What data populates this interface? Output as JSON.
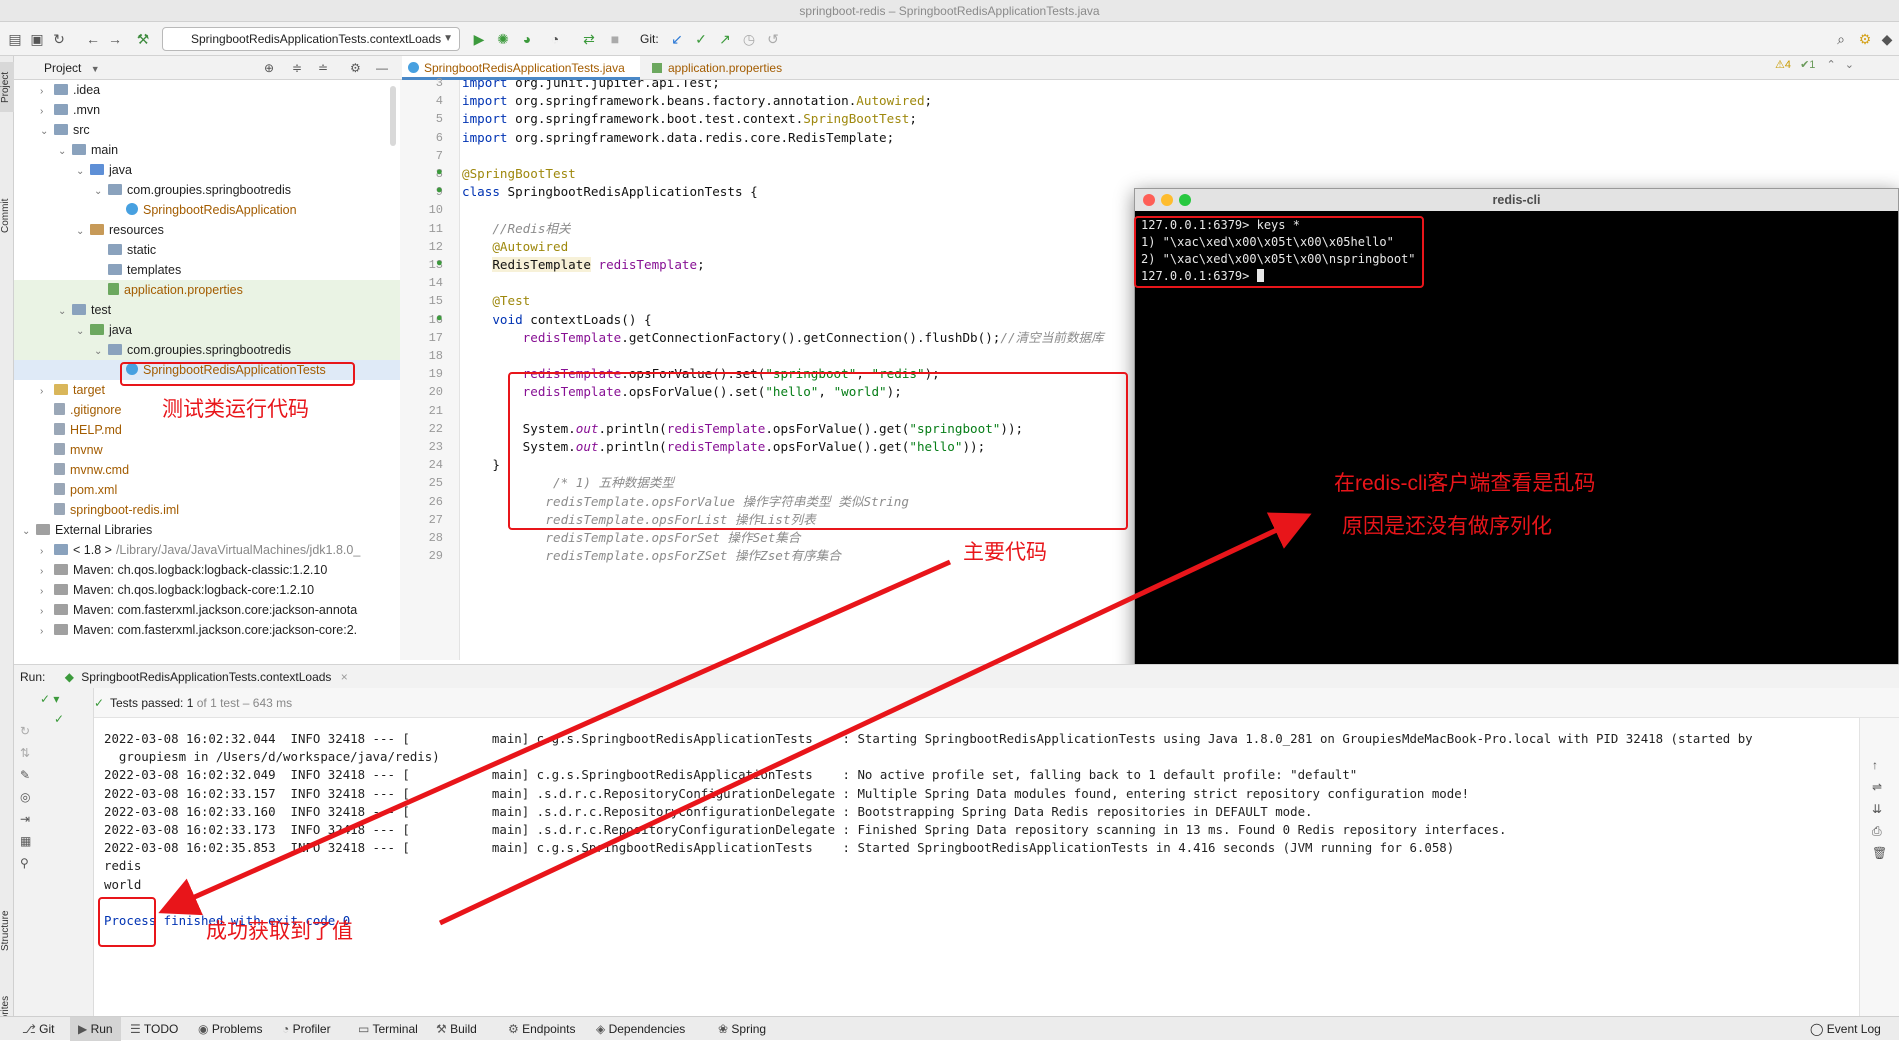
{
  "window_title": "springboot-redis – SpringbootRedisApplicationTests.java",
  "toolbar": {
    "run_config": "SpringbootRedisApplicationTests.contextLoads",
    "git_label": "Git:"
  },
  "sidebar_labels": {
    "project": "Project",
    "commit": "Commit",
    "structure": "Structure",
    "favorites": "Favorites"
  },
  "project_panel": {
    "title": "Project"
  },
  "tree": [
    {
      "label": ".idea",
      "indent": 1,
      "arrow": "›",
      "icon": "folder"
    },
    {
      "label": ".mvn",
      "indent": 1,
      "arrow": "›",
      "icon": "folder"
    },
    {
      "label": "src",
      "indent": 1,
      "arrow": "⌄",
      "icon": "folder"
    },
    {
      "label": "main",
      "indent": 2,
      "arrow": "⌄",
      "icon": "folder"
    },
    {
      "label": "java",
      "indent": 3,
      "arrow": "⌄",
      "icon": "folder-b"
    },
    {
      "label": "com.groupies.springbootredis",
      "indent": 4,
      "arrow": "⌄",
      "icon": "package"
    },
    {
      "label": "SpringbootRedisApplication",
      "indent": 5,
      "arrow": "",
      "icon": "class",
      "color": "#a35c00"
    },
    {
      "label": "resources",
      "indent": 3,
      "arrow": "⌄",
      "icon": "folder-o"
    },
    {
      "label": "static",
      "indent": 4,
      "arrow": "",
      "icon": "folder"
    },
    {
      "label": "templates",
      "indent": 4,
      "arrow": "",
      "icon": "folder"
    },
    {
      "label": "application.properties",
      "indent": 4,
      "arrow": "",
      "icon": "props",
      "color": "#a35c00"
    },
    {
      "label": "test",
      "indent": 2,
      "arrow": "⌄",
      "icon": "folder"
    },
    {
      "label": "java",
      "indent": 3,
      "arrow": "⌄",
      "icon": "folder-g"
    },
    {
      "label": "com.groupies.springbootredis",
      "indent": 4,
      "arrow": "⌄",
      "icon": "package"
    },
    {
      "label": "SpringbootRedisApplicationTests",
      "indent": 5,
      "arrow": "",
      "icon": "class",
      "color": "#a35c00"
    },
    {
      "label": "target",
      "indent": 1,
      "arrow": "›",
      "icon": "folder-y",
      "color": "#a35c00"
    },
    {
      "label": ".gitignore",
      "indent": 1,
      "arrow": "",
      "icon": "file",
      "color": "#a35c00"
    },
    {
      "label": "HELP.md",
      "indent": 1,
      "arrow": "",
      "icon": "file",
      "color": "#a35c00"
    },
    {
      "label": "mvnw",
      "indent": 1,
      "arrow": "",
      "icon": "file",
      "color": "#a35c00"
    },
    {
      "label": "mvnw.cmd",
      "indent": 1,
      "arrow": "",
      "icon": "file",
      "color": "#a35c00"
    },
    {
      "label": "pom.xml",
      "indent": 1,
      "arrow": "",
      "icon": "file",
      "color": "#a35c00"
    },
    {
      "label": "springboot-redis.iml",
      "indent": 1,
      "arrow": "",
      "icon": "file",
      "color": "#a35c00"
    },
    {
      "label": "External Libraries",
      "indent": 0,
      "arrow": "⌄",
      "icon": "lib"
    },
    {
      "label": "< 1.8 >",
      "suffix": "/Library/Java/JavaVirtualMachines/jdk1.8.0_",
      "indent": 1,
      "arrow": "›",
      "icon": "folder"
    },
    {
      "label": "Maven: ch.qos.logback:logback-classic:1.2.10",
      "indent": 1,
      "arrow": "›",
      "icon": "lib"
    },
    {
      "label": "Maven: ch.qos.logback:logback-core:1.2.10",
      "indent": 1,
      "arrow": "›",
      "icon": "lib"
    },
    {
      "label": "Maven: com.fasterxml.jackson.core:jackson-annota",
      "indent": 1,
      "arrow": "›",
      "icon": "lib"
    },
    {
      "label": "Maven: com.fasterxml.jackson.core:jackson-core:2.",
      "indent": 1,
      "arrow": "›",
      "icon": "lib"
    }
  ],
  "editor_tabs": [
    "SpringbootRedisApplicationTests.java",
    "application.properties"
  ],
  "inspections": {
    "warnings": "4",
    "weak": "1"
  },
  "code": [
    {
      "n": "3",
      "html": "<span class='kw'>import</span> org.junit.jupiter.api.Test;"
    },
    {
      "n": "4",
      "html": "<span class='kw'>import</span> org.springframework.beans.factory.annotation.<span class='ann'>Autowired</span>;"
    },
    {
      "n": "5",
      "html": "<span class='kw'>import</span> org.springframework.boot.test.context.<span class='ann'>SpringBootTest</span>;"
    },
    {
      "n": "6",
      "html": "<span class='kw'>import</span> org.springframework.data.redis.core.RedisTemplate;"
    },
    {
      "n": "7",
      "html": ""
    },
    {
      "n": "8",
      "html": "<span class='ann'>@SpringBootTest</span>"
    },
    {
      "n": "9",
      "html": "<span class='kw'>class</span> SpringbootRedisApplicationTests {"
    },
    {
      "n": "10",
      "html": ""
    },
    {
      "n": "11",
      "html": "    <span class='cmt'>//Redis相关</span>"
    },
    {
      "n": "12",
      "html": "    <span class='ann'>@Autowired</span>"
    },
    {
      "n": "13",
      "html": "    <span style='background:#f7f1d8'>RedisTemplate</span> <span class='fld'>redisTemplate</span>;"
    },
    {
      "n": "14",
      "html": ""
    },
    {
      "n": "15",
      "html": "    <span class='ann'>@Test</span>"
    },
    {
      "n": "16",
      "html": "    <span class='kw'>void</span> contextLoads() {"
    },
    {
      "n": "17",
      "html": "        <span class='fld'>redisTemplate</span>.getConnectionFactory().getConnection().flushDb();<span class='cmt'>//清空当前数据库</span>"
    },
    {
      "n": "18",
      "html": ""
    },
    {
      "n": "19",
      "html": "        <span class='fld'>redisTemplate</span>.opsForValue().set(<span class='str'>\"springboot\"</span>, <span class='str'>\"redis\"</span>);"
    },
    {
      "n": "20",
      "html": "        <span class='fld'>redisTemplate</span>.opsForValue().set(<span class='str'>\"hello\"</span>, <span class='str'>\"world\"</span>);"
    },
    {
      "n": "21",
      "html": ""
    },
    {
      "n": "22",
      "html": "        System.<span class='fld' style='font-style:italic'>out</span>.println(<span class='fld'>redisTemplate</span>.opsForValue().get(<span class='str'>\"springboot\"</span>));"
    },
    {
      "n": "23",
      "html": "        System.<span class='fld' style='font-style:italic'>out</span>.println(<span class='fld'>redisTemplate</span>.opsForValue().get(<span class='str'>\"hello\"</span>));"
    },
    {
      "n": "24",
      "html": "    }"
    },
    {
      "n": "25",
      "html": "            <span class='cmt'>/* 1) 五种数据类型</span>"
    },
    {
      "n": "26",
      "html": "           <span class='cmt'>redisTemplate.opsForValue 操作字符串类型 类似String</span>"
    },
    {
      "n": "27",
      "html": "           <span class='cmt'>redisTemplate.opsForList 操作List列表</span>"
    },
    {
      "n": "28",
      "html": "           <span class='cmt'>redisTemplate.opsForSet 操作Set集合</span>"
    },
    {
      "n": "29",
      "html": "           <span class='cmt'>redisTemplate.opsForZSet 操作Zset有序集合</span>"
    }
  ],
  "terminal": {
    "title": "redis-cli",
    "lines": [
      "127.0.0.1:6379> keys *",
      "1) \"\\xac\\xed\\x00\\x05t\\x00\\x05hello\"",
      "2) \"\\xac\\xed\\x00\\x05t\\x00\\nspringboot\"",
      "127.0.0.1:6379> "
    ]
  },
  "run": {
    "label": "Run:",
    "tab": "SpringbootRedisApplicationTests.contextLoads",
    "status_prefix": "Tests passed:",
    "status_count": "1",
    "status_rest": "of 1 test – 643 ms"
  },
  "console": [
    {
      "text": "2022-03-08 16:02:32.044  INFO 32418 --- [           main] c.g.s.SpringbootRedisApplicationTests    : Starting SpringbootRedisApplicationTests using Java 1.8.0_281 on GroupiesMdeMacBook-Pro.local with PID 32418 (started by"
    },
    {
      "text": "  groupiesm in /Users/d/workspace/java/redis)"
    },
    {
      "text": "2022-03-08 16:02:32.049  INFO 32418 --- [           main] c.g.s.SpringbootRedisApplicationTests    : No active profile set, falling back to 1 default profile: \"default\""
    },
    {
      "text": "2022-03-08 16:02:33.157  INFO 32418 --- [           main] .s.d.r.c.RepositoryConfigurationDelegate : Multiple Spring Data modules found, entering strict repository configuration mode!"
    },
    {
      "text": "2022-03-08 16:02:33.160  INFO 32418 --- [           main] .s.d.r.c.RepositoryConfigurationDelegate : Bootstrapping Spring Data Redis repositories in DEFAULT mode."
    },
    {
      "text": "2022-03-08 16:02:33.173  INFO 32418 --- [           main] .s.d.r.c.RepositoryConfigurationDelegate : Finished Spring Data repository scanning in 13 ms. Found 0 Redis repository interfaces."
    },
    {
      "text": "2022-03-08 16:02:35.853  INFO 32418 --- [           main] c.g.s.SpringbootRedisApplicationTests    : Started SpringbootRedisApplicationTests in 4.416 seconds (JVM running for 6.058)"
    },
    {
      "text": "redis"
    },
    {
      "text": "world"
    },
    {
      "text": ""
    },
    {
      "text": "Process finished with exit code 0",
      "color": "#0033b3"
    }
  ],
  "bottom_tabs": [
    "Git",
    "Run",
    "TODO",
    "Problems",
    "Profiler",
    "Terminal",
    "Build",
    "Endpoints",
    "Dependencies",
    "Spring"
  ],
  "event_log": "Event Log",
  "annotations": {
    "test_class": "测试类运行代码",
    "main_code": "主要代码",
    "garbled_1": "在redis-cli客户端查看是乱码",
    "garbled_2": "原因是还没有做序列化",
    "success": "成功获取到了值"
  },
  "colors": {
    "annotation_red": "#e8151a",
    "terminal_bg": "#000000"
  }
}
